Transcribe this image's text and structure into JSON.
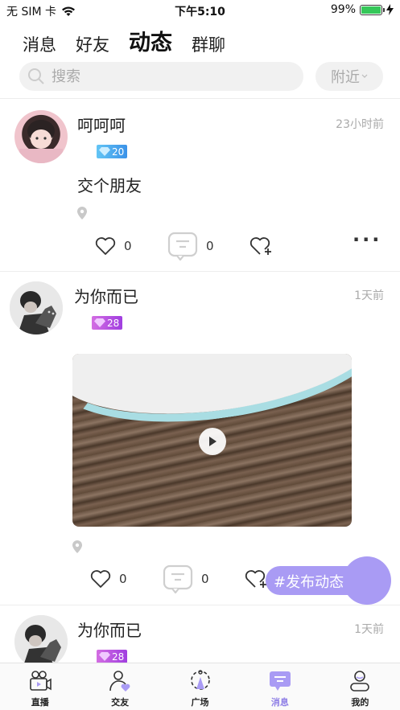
{
  "status_bar": {
    "carrier": "无 SIM 卡",
    "time": "下午5:10",
    "battery": "99%",
    "battery_level": 0.99
  },
  "top_tabs": [
    {
      "label": "消息",
      "active": false
    },
    {
      "label": "好友",
      "active": false
    },
    {
      "label": "动态",
      "active": true
    },
    {
      "label": "群聊",
      "active": false
    }
  ],
  "search": {
    "placeholder": "搜索",
    "filter_label": "附近"
  },
  "posts": [
    {
      "name": "呵呵呵",
      "time": "23小时前",
      "level": "20",
      "text": "交个朋友",
      "likes": "0",
      "comments": "0"
    },
    {
      "name": "为你而已",
      "time": "1天前",
      "level": "28",
      "has_video": true,
      "likes": "0",
      "comments": "0"
    },
    {
      "name": "为你而已",
      "time": "1天前",
      "level": "28"
    }
  ],
  "fab": {
    "label": "#发布动态"
  },
  "tab_bar": [
    {
      "label": "直播",
      "icon": "live-icon",
      "active": false
    },
    {
      "label": "交友",
      "icon": "friends-icon",
      "active": false
    },
    {
      "label": "广场",
      "icon": "plaza-icon",
      "active": false
    },
    {
      "label": "消息",
      "icon": "message-icon",
      "active": true
    },
    {
      "label": "我的",
      "icon": "profile-icon",
      "active": false
    }
  ],
  "colors": {
    "accent": "#a99bf4",
    "tab_active": "#8f7fe6",
    "level_blue": "#3b92e8",
    "level_purple": "#a03ee0"
  }
}
